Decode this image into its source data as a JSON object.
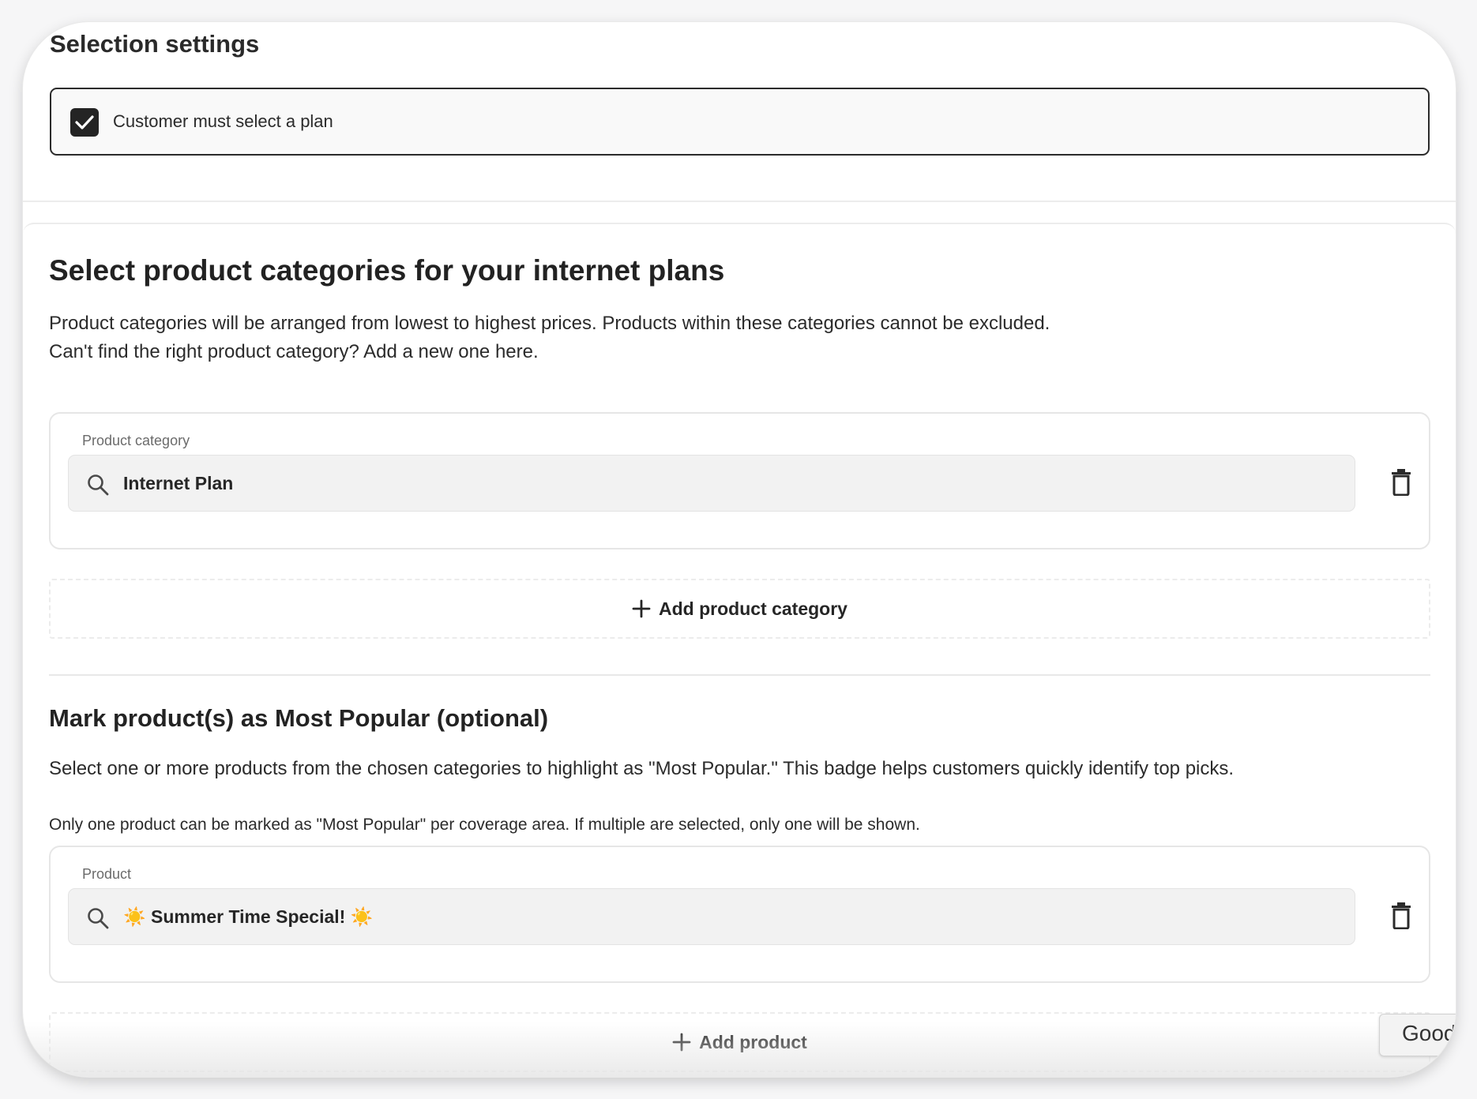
{
  "selection_settings": {
    "title": "Selection settings",
    "checkbox_label": "Customer must select a plan",
    "checkbox_checked": true
  },
  "categories_section": {
    "title": "Select product categories for your internet plans",
    "description_line1": "Product categories will be arranged from lowest to highest prices. Products within these categories cannot be excluded.",
    "description_line2": "Can't find the right product category? Add a new one here.",
    "field_label": "Product category",
    "field_value": "Internet Plan",
    "add_button_label": "Add product category"
  },
  "popular_section": {
    "title": "Mark product(s) as Most Popular (optional)",
    "description": "Select one or more products from the chosen categories to highlight as \"Most Popular.\" This badge helps customers quickly identify top picks.",
    "note": "Only one product can be marked as \"Most Popular\" per coverage area. If multiple are selected, only one will be shown.",
    "field_label": "Product",
    "field_value": "☀️ Summer Time Special! ☀️",
    "add_button_label": "Add product"
  },
  "floating_button": {
    "label": "Good"
  },
  "icons": {
    "check": "checkmark-icon",
    "search": "search-icon",
    "delete": "trash-icon",
    "add": "plus-icon"
  },
  "colors": {
    "checkbox_fill": "#242424",
    "field_bg": "#f2f2f2",
    "text": "#232323"
  }
}
